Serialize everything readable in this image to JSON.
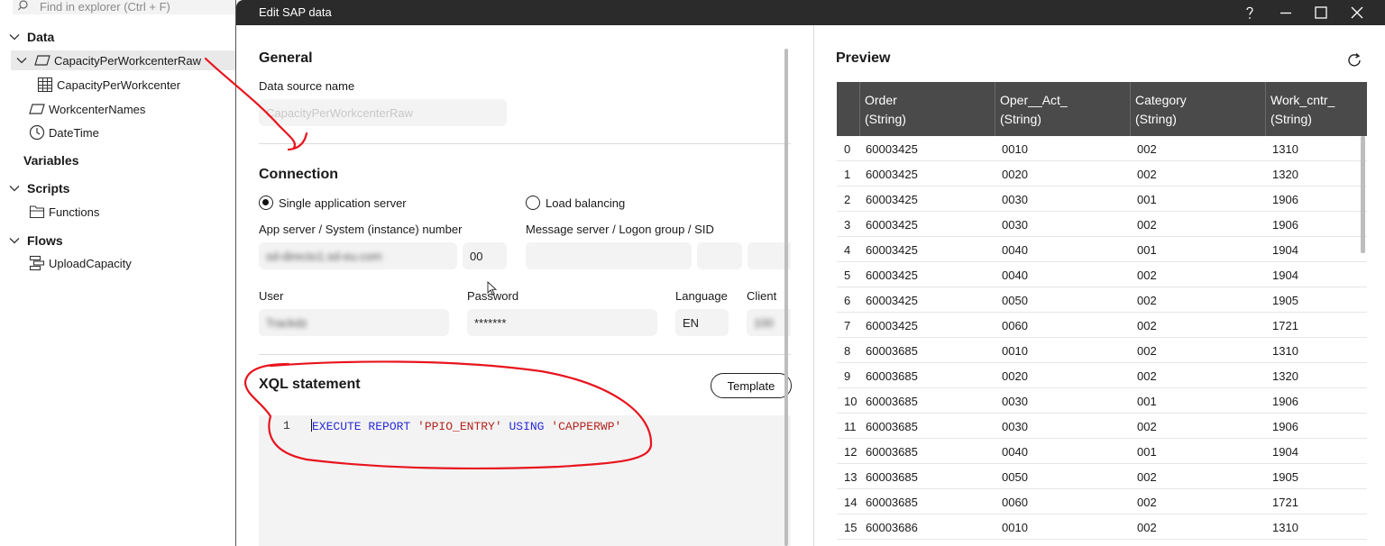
{
  "explorer": {
    "search_placeholder": "Find in explorer (Ctrl + F)",
    "sections": {
      "data": "Data",
      "variables": "Variables",
      "scripts": "Scripts",
      "flows": "Flows"
    },
    "items": {
      "capacity_raw": "CapacityPerWorkcenterRaw",
      "capacity": "CapacityPerWorkcenter",
      "workcenter_names": "WorkcenterNames",
      "datetime": "DateTime",
      "functions": "Functions",
      "upload_capacity": "UploadCapacity"
    }
  },
  "dialog": {
    "title": "Edit SAP data",
    "general": {
      "heading": "General",
      "data_source_label": "Data source name",
      "data_source_value": "CapacityPerWorkcenterRaw"
    },
    "connection": {
      "heading": "Connection",
      "radio_single": "Single application server",
      "radio_load": "Load balancing",
      "app_server_label": "App server / System (instance) number",
      "app_server_value": "sd-directo1.sd-eu.com",
      "instance_value": "00",
      "message_server_label": "Message server / Logon group / SID",
      "user_label": "User",
      "user_value": "Trackdz",
      "password_label": "Password",
      "password_value": "*******",
      "language_label": "Language",
      "language_value": "EN",
      "client_label": "Client",
      "client_value": "100"
    },
    "xql": {
      "heading": "XQL statement",
      "template_button": "Template",
      "line_number": "1",
      "kw_execute": "EXECUTE REPORT",
      "str_report": "'PPIO_ENTRY'",
      "kw_using": "USING",
      "str_variant": "'CAPPERWP'"
    }
  },
  "preview": {
    "heading": "Preview",
    "columns": [
      {
        "name": "Order",
        "type": "(String)"
      },
      {
        "name": "Oper__Act_",
        "type": "(String)"
      },
      {
        "name": "Category",
        "type": "(String)"
      },
      {
        "name": "Work_cntr_",
        "type": "(String)"
      }
    ],
    "rows": [
      [
        "0",
        "60003425",
        "0010",
        "002",
        "1310"
      ],
      [
        "1",
        "60003425",
        "0020",
        "002",
        "1320"
      ],
      [
        "2",
        "60003425",
        "0030",
        "001",
        "1906"
      ],
      [
        "3",
        "60003425",
        "0030",
        "002",
        "1906"
      ],
      [
        "4",
        "60003425",
        "0040",
        "001",
        "1904"
      ],
      [
        "5",
        "60003425",
        "0040",
        "002",
        "1904"
      ],
      [
        "6",
        "60003425",
        "0050",
        "002",
        "1905"
      ],
      [
        "7",
        "60003425",
        "0060",
        "002",
        "1721"
      ],
      [
        "8",
        "60003685",
        "0010",
        "002",
        "1310"
      ],
      [
        "9",
        "60003685",
        "0020",
        "002",
        "1320"
      ],
      [
        "10",
        "60003685",
        "0030",
        "001",
        "1906"
      ],
      [
        "11",
        "60003685",
        "0030",
        "002",
        "1906"
      ],
      [
        "12",
        "60003685",
        "0040",
        "001",
        "1904"
      ],
      [
        "13",
        "60003685",
        "0050",
        "002",
        "1905"
      ],
      [
        "14",
        "60003685",
        "0060",
        "002",
        "1721"
      ],
      [
        "15",
        "60003686",
        "0010",
        "002",
        "1310"
      ]
    ]
  },
  "colors": {
    "titlebar": "#2b2b2b",
    "grid_header": "#4a4a4a",
    "annotation": "#e8141e",
    "keyword": "#2a2ad8",
    "string": "#b3261e"
  }
}
